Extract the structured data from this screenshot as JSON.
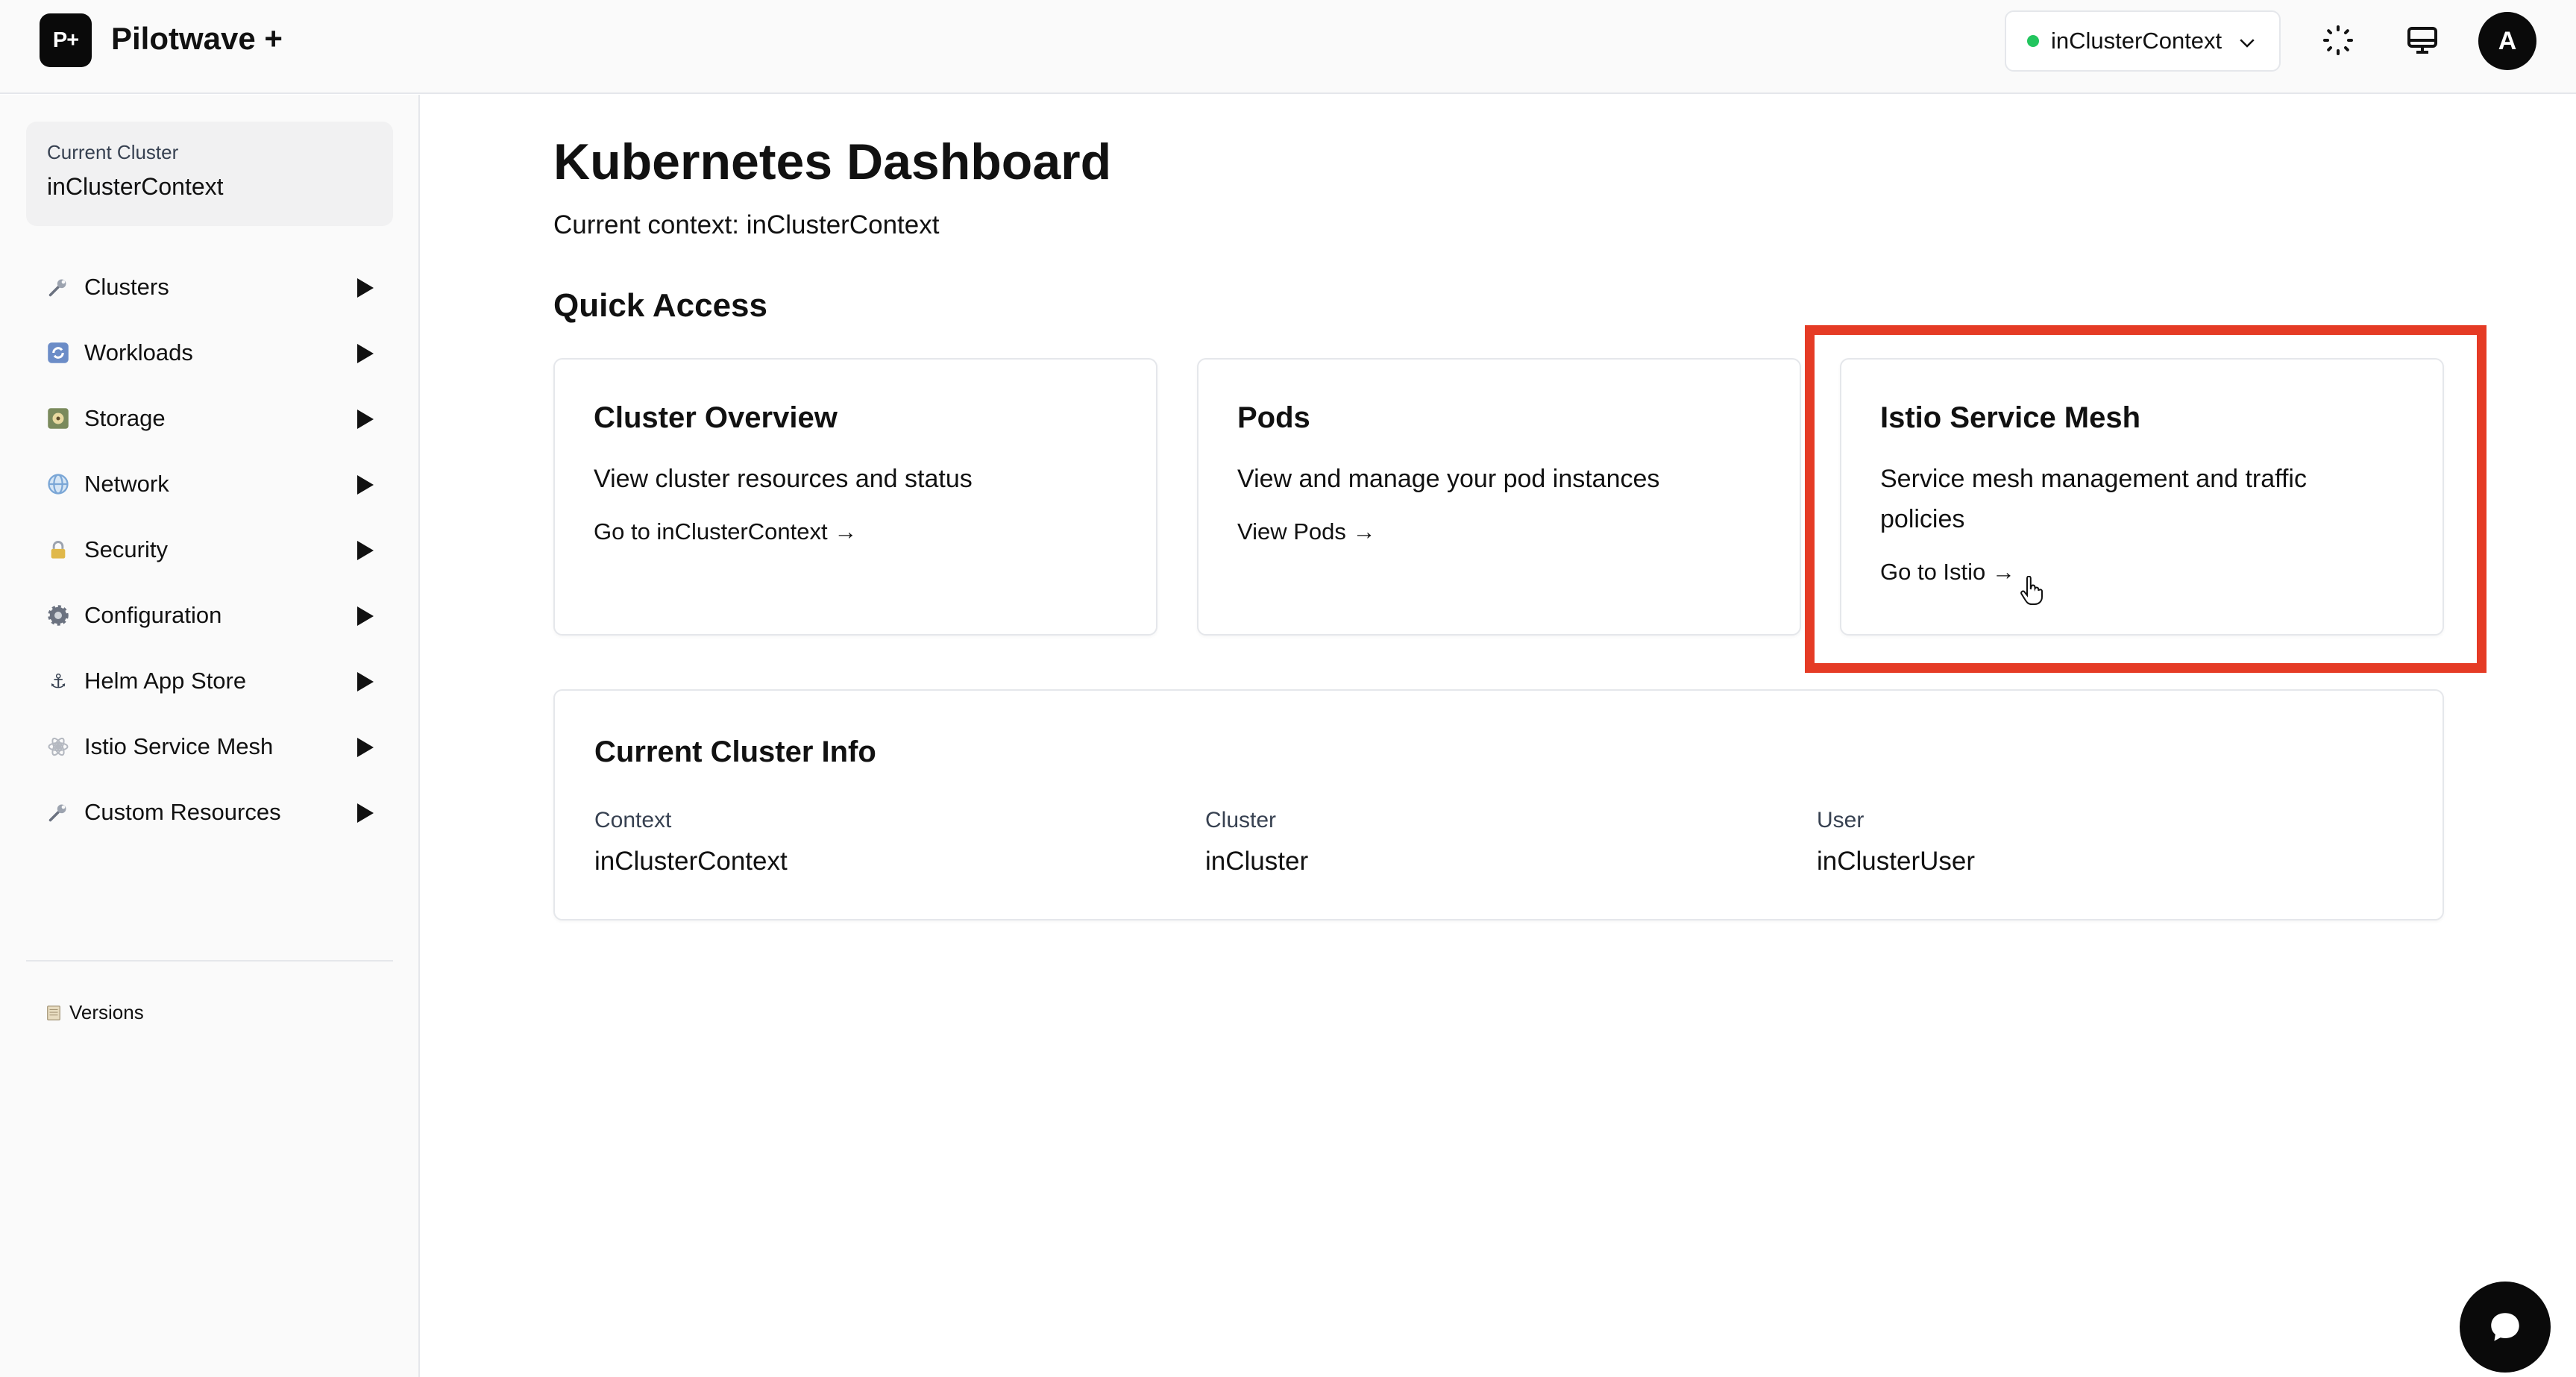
{
  "header": {
    "logo_text": "P+",
    "app_title": "Pilotwave +",
    "context_selector": "inClusterContext",
    "avatar_initial": "A",
    "icons": [
      "loader-icon",
      "monitor-icon"
    ]
  },
  "sidebar": {
    "current_cluster_label": "Current Cluster",
    "current_cluster_value": "inClusterContext",
    "items": [
      {
        "label": "Clusters",
        "icon": "wrench-icon"
      },
      {
        "label": "Workloads",
        "icon": "refresh-icon"
      },
      {
        "label": "Storage",
        "icon": "storage-icon"
      },
      {
        "label": "Network",
        "icon": "globe-icon"
      },
      {
        "label": "Security",
        "icon": "lock-icon"
      },
      {
        "label": "Configuration",
        "icon": "gear-icon"
      },
      {
        "label": "Helm App Store",
        "icon": "anchor-icon"
      },
      {
        "label": "Istio Service Mesh",
        "icon": "mesh-icon"
      },
      {
        "label": "Custom Resources",
        "icon": "wrench-icon"
      }
    ],
    "versions_label": "Versions"
  },
  "main": {
    "title": "Kubernetes Dashboard",
    "context_prefix": "Current context: ",
    "context_value": "inClusterContext",
    "quick_access_title": "Quick Access",
    "cards": [
      {
        "title": "Cluster Overview",
        "description": "View cluster resources and status",
        "link": "Go to inClusterContext →"
      },
      {
        "title": "Pods",
        "description": "View and manage your pod instances",
        "link": "View Pods →"
      },
      {
        "title": "Istio Service Mesh",
        "description": "Service mesh management and traffic policies",
        "link": "Go to Istio →"
      }
    ],
    "cluster_info": {
      "title": "Current Cluster Info",
      "fields": [
        {
          "label": "Context",
          "value": "inClusterContext"
        },
        {
          "label": "Cluster",
          "value": "inCluster"
        },
        {
          "label": "User",
          "value": "inClusterUser"
        }
      ]
    }
  },
  "colors": {
    "highlight": "#e53b25",
    "status_dot": "#22c55e",
    "brand_dark": "#0a0a0a"
  }
}
